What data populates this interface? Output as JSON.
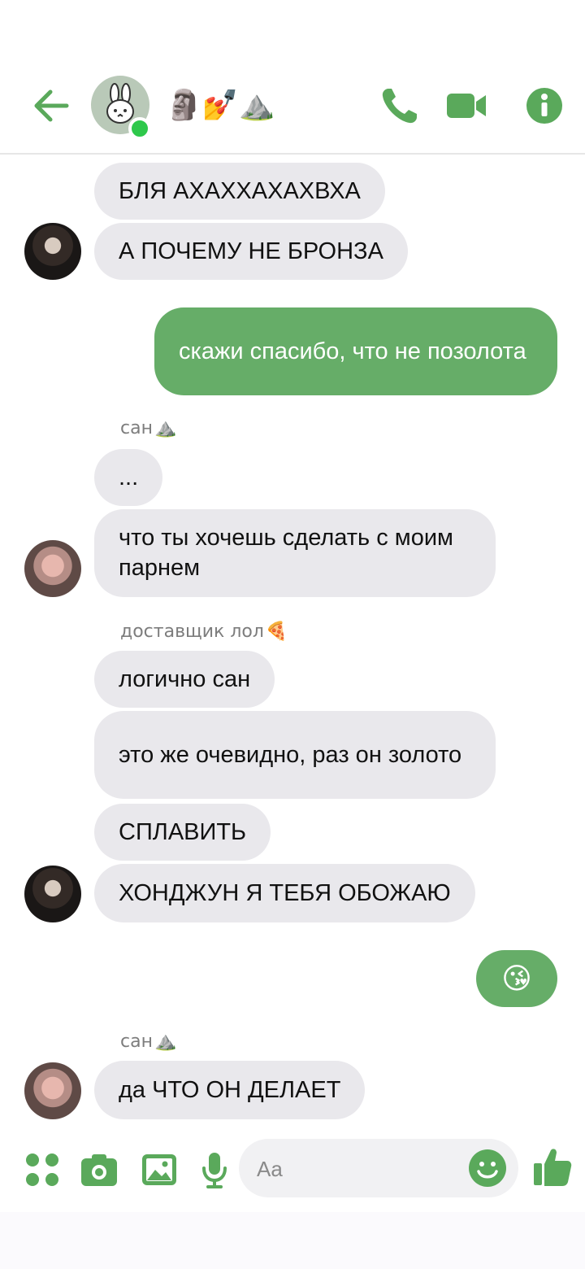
{
  "header": {
    "title": "🗿💅⛰️"
  },
  "messages": [
    {
      "text": "БЛЯ АХАХХАХАХВХА"
    },
    {
      "text": "А ПОЧЕМУ НЕ БРОНЗА"
    },
    {
      "text": "скажи спасибо, что не позолота"
    },
    {
      "sender": "сан",
      "sender_emoji": "⛰️"
    },
    {
      "text": "..."
    },
    {
      "text": "что ты хочешь сделать с моим парнем"
    },
    {
      "sender": "доставщик лол",
      "sender_emoji": "🍕"
    },
    {
      "text": "логично сан"
    },
    {
      "text": "это же очевидно, раз он золото"
    },
    {
      "text": "СПЛАВИТЬ"
    },
    {
      "text": "ХОНДЖУН Я ТЕБЯ ОБОЖАЮ"
    },
    {
      "text": "😘"
    },
    {
      "sender": "сан",
      "sender_emoji": "⛰️"
    },
    {
      "text": "да ЧТО ОН ДЕЛАЕТ"
    }
  ],
  "composer": {
    "placeholder": "Aa"
  },
  "icons": {
    "back": "arrow-left-icon",
    "call": "phone-icon",
    "video": "video-camera-icon",
    "info": "info-icon",
    "menu": "four-dots-icon",
    "camera": "camera-icon",
    "gallery": "image-icon",
    "voice": "microphone-icon",
    "emoji": "smiley-icon",
    "like": "thumbs-up-icon"
  },
  "colors": {
    "accent": "#5aa95b",
    "outgoing_bubble": "#66ad68",
    "incoming_bubble": "#e9e8ec",
    "online": "#2ec84b"
  }
}
